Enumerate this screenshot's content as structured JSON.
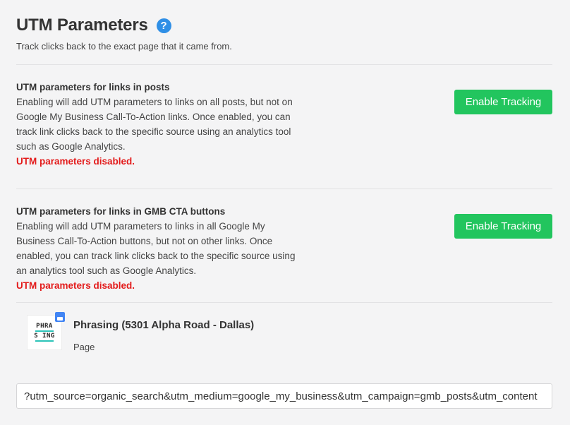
{
  "header": {
    "title": "UTM Parameters",
    "help_icon": "?",
    "subtitle": "Track clicks back to the exact page that it came from."
  },
  "sections": [
    {
      "heading": "UTM parameters for links in posts",
      "description": "Enabling will add UTM parameters to links on all posts, but not on Google My Business Call-To-Action links. Once enabled, you can track link clicks back to the specific source using an analytics tool such as Google Analytics.",
      "status": "UTM parameters disabled.",
      "button_label": "Enable Tracking"
    },
    {
      "heading": "UTM parameters for links in GMB CTA buttons",
      "description": "Enabling will add UTM parameters to links in all Google My Business Call-To-Action buttons, but not on other links. Once enabled, you can track link clicks back to the specific source using an analytics tool such as Google Analytics.",
      "status": "UTM parameters disabled.",
      "button_label": "Enable Tracking"
    }
  ],
  "account": {
    "avatar_line1": "PHRA",
    "avatar_line2": "S ING",
    "avatar_badge_icon": "google-my-business-icon",
    "name": "Phrasing (5301 Alpha Road - Dallas)",
    "type": "Page"
  },
  "utm": {
    "value": "?utm_source=organic_search&utm_medium=google_my_business&utm_campaign=gmb_posts&utm_content"
  },
  "colors": {
    "accent_green": "#22c55e",
    "status_red": "#e31b1b",
    "help_blue": "#2f8fe6"
  }
}
